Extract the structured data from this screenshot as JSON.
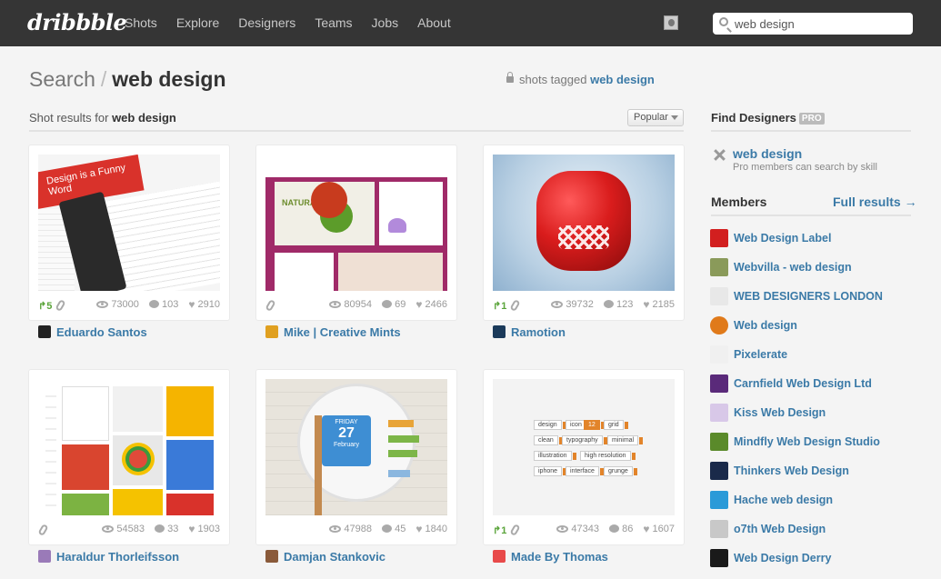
{
  "header": {
    "logo": "dribbble",
    "nav": [
      "Shots",
      "Explore",
      "Designers",
      "Teams",
      "Jobs",
      "About"
    ],
    "search_value": "web design"
  },
  "title": {
    "prefix": "Search",
    "sep": "/",
    "term": "web design"
  },
  "tagged": {
    "prefix": "shots tagged",
    "tag": "web design"
  },
  "results": {
    "prefix": "Shot results for",
    "term": "web design",
    "sort": "Popular"
  },
  "shots": [
    {
      "rebounds": "5",
      "views": "73000",
      "comments": "103",
      "likes": "2910",
      "author": "Eduardo Santos",
      "author_color": "#222222"
    },
    {
      "rebounds": "",
      "views": "80954",
      "comments": "69",
      "likes": "2466",
      "author": "Mike | Creative Mints",
      "author_color": "#e0a020"
    },
    {
      "rebounds": "1",
      "views": "39732",
      "comments": "123",
      "likes": "2185",
      "author": "Ramotion",
      "author_color": "#1b3a5a"
    },
    {
      "rebounds": "",
      "views": "54583",
      "comments": "33",
      "likes": "1903",
      "author": "Haraldur Thorleifsson",
      "author_color": "#9a7ab8"
    },
    {
      "rebounds": "",
      "views": "47988",
      "comments": "45",
      "likes": "1840",
      "author": "Damjan Stankovic",
      "author_color": "#8a5a3a"
    },
    {
      "rebounds": "1",
      "views": "47343",
      "comments": "86",
      "likes": "1607",
      "author": "Made By Thomas",
      "author_color": "#e84a4a"
    }
  ],
  "thumb_text": {
    "t1": "Design is a Funny Word",
    "t2": "NATURAL FOOD",
    "t5_day": "FRIDAY",
    "t5_date": "27",
    "t5_month": "February",
    "t6_tags": [
      "design",
      "icon",
      "12",
      "grid",
      "clean",
      "typography",
      "minimal",
      "illustration",
      "high resolution",
      "iphone",
      "interface",
      "grunge"
    ]
  },
  "sidebar": {
    "find_title": "Find Designers",
    "pro": "PRO",
    "skill": "web design",
    "skill_note": "Pro members can search by skill",
    "members_title": "Members",
    "full_results": "Full results →",
    "members": [
      {
        "name": "Web Design Label",
        "color": "#d21f1f"
      },
      {
        "name": "Webvilla - web design",
        "color": "#8a9a5a"
      },
      {
        "name": "WEB DESIGNERS LONDON",
        "color": "#e8e8e8"
      },
      {
        "name": "Web design",
        "color": "#e07a1a"
      },
      {
        "name": "Pixelerate",
        "color": "#f0f0f0"
      },
      {
        "name": "Carnfield Web Design Ltd",
        "color": "#5a2a7a"
      },
      {
        "name": "Kiss Web Design",
        "color": "#d8c8e8"
      },
      {
        "name": "Mindfly Web Design Studio",
        "color": "#5a8a2a"
      },
      {
        "name": "Thinkers Web Design",
        "color": "#1a2a4a"
      },
      {
        "name": "Hache web design",
        "color": "#2a9ad8"
      },
      {
        "name": "o7th Web Design",
        "color": "#c8c8c8"
      },
      {
        "name": "Web Design Derry",
        "color": "#1a1a1a"
      }
    ]
  }
}
